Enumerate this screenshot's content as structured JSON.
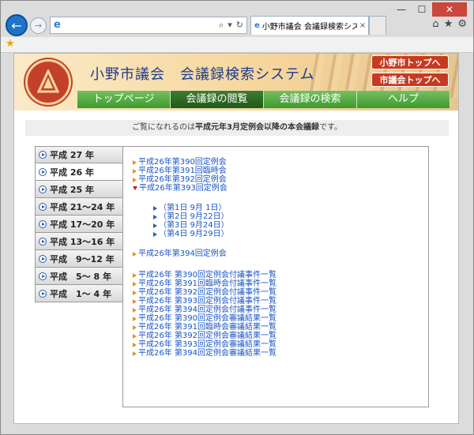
{
  "browser": {
    "tab_title": "小野市議会 会議録検索シス...",
    "address_value": "",
    "tab_close": "×",
    "win_minimize": "—",
    "win_maximize": "☐",
    "win_close": "✕"
  },
  "header": {
    "site_title": "小野市議会　会議録検索システム",
    "top_links": [
      "小野市トップへ",
      "市議会トップへ"
    ]
  },
  "gnav": {
    "items": [
      {
        "label": "トップページ",
        "active": false
      },
      {
        "label": "会議録の閲覧",
        "active": true
      },
      {
        "label": "会議録の検索",
        "active": false
      },
      {
        "label": "ヘルプ",
        "active": false
      }
    ]
  },
  "notice": {
    "before": "ご覧になれるのは",
    "bold": "平成元年3月定例会以降の本会議録",
    "after": "です。"
  },
  "years": [
    {
      "label": "平成 27 年",
      "active": false
    },
    {
      "label": "平成 26 年",
      "active": true
    },
    {
      "label": "平成 25 年",
      "active": false
    },
    {
      "label": "平成 21～24 年",
      "active": false
    },
    {
      "label": "平成 17～20 年",
      "active": false
    },
    {
      "label": "平成 13～16 年",
      "active": false
    },
    {
      "label": "平成　9～12 年",
      "active": false
    },
    {
      "label": "平成　5～ 8 年",
      "active": false
    },
    {
      "label": "平成　1～ 4 年",
      "active": false
    }
  ],
  "sessions": [
    {
      "label": "平成26年第390回定例会",
      "expanded": false
    },
    {
      "label": "平成26年第391回臨時会",
      "expanded": false
    },
    {
      "label": "平成26年第392回定例会",
      "expanded": false
    },
    {
      "label": "平成26年第393回定例会",
      "expanded": true
    }
  ],
  "days": [
    "（第1日 9月 1日）",
    "（第2日 9月22日）",
    "（第3日 9月24日）",
    "（第4日 9月29日）"
  ],
  "session_last": "平成26年第394回定例会",
  "lists": [
    "平成26年 第390回定例会付議事件一覧",
    "平成26年 第391回臨時会付議事件一覧",
    "平成26年 第392回定例会付議事件一覧",
    "平成26年 第393回定例会付議事件一覧",
    "平成26年 第394回定例会付議事件一覧",
    "平成26年 第390回定例会審議結果一覧",
    "平成26年 第391回臨時会審議結果一覧",
    "平成26年 第392回定例会審議結果一覧",
    "平成26年 第393回定例会審議結果一覧",
    "平成26年 第394回定例会審議結果一覧"
  ],
  "colors": {
    "link": "#1a56c4",
    "nav_green": "#3d9a2e",
    "header_red": "#c73a22"
  }
}
